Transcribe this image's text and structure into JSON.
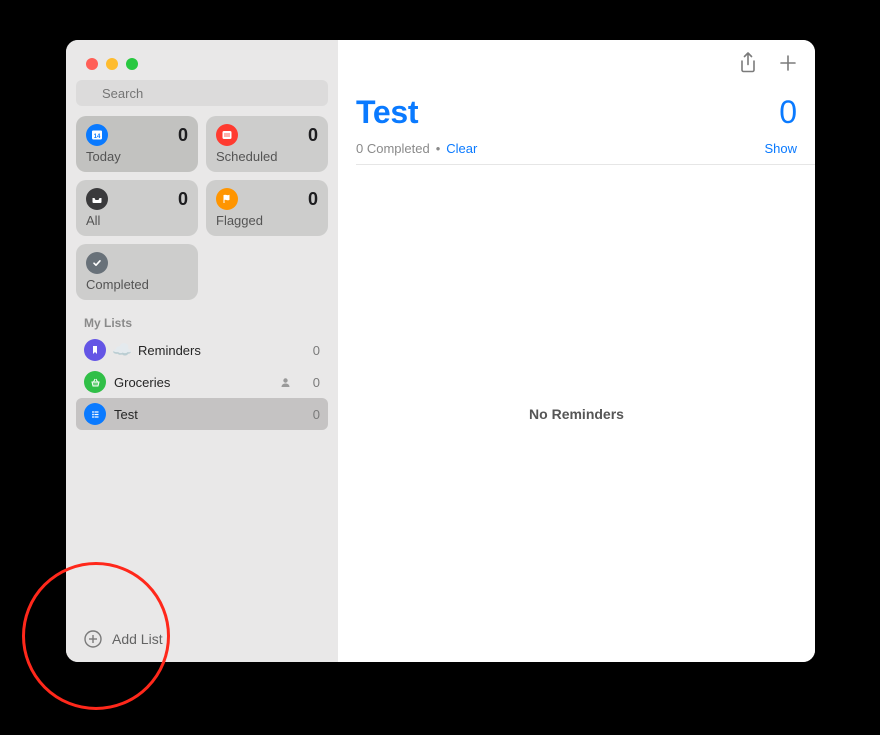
{
  "search": {
    "placeholder": "Search"
  },
  "smart": {
    "today": {
      "label": "Today",
      "count": "0",
      "color": "#0a7aff"
    },
    "scheduled": {
      "label": "Scheduled",
      "count": "0",
      "color": "#ff3b30"
    },
    "all": {
      "label": "All",
      "count": "0",
      "color": "#3a3a3c"
    },
    "flagged": {
      "label": "Flagged",
      "count": "0",
      "color": "#ff9500"
    },
    "completed": {
      "label": "Completed",
      "color": "#687179"
    }
  },
  "my_lists": {
    "header": "My Lists",
    "items": [
      {
        "name": "Reminders",
        "count": "0",
        "color": "#6455e5"
      },
      {
        "name": "Groceries",
        "count": "0",
        "color": "#30bf47",
        "shared": true
      },
      {
        "name": "Test",
        "count": "0",
        "color": "#0a7aff",
        "selected": true
      }
    ]
  },
  "add_list": {
    "label": "Add List"
  },
  "main": {
    "title": "Test",
    "count": "0",
    "completed_text": "0 Completed",
    "dot": "•",
    "clear": "Clear",
    "show": "Show",
    "empty": "No Reminders"
  }
}
